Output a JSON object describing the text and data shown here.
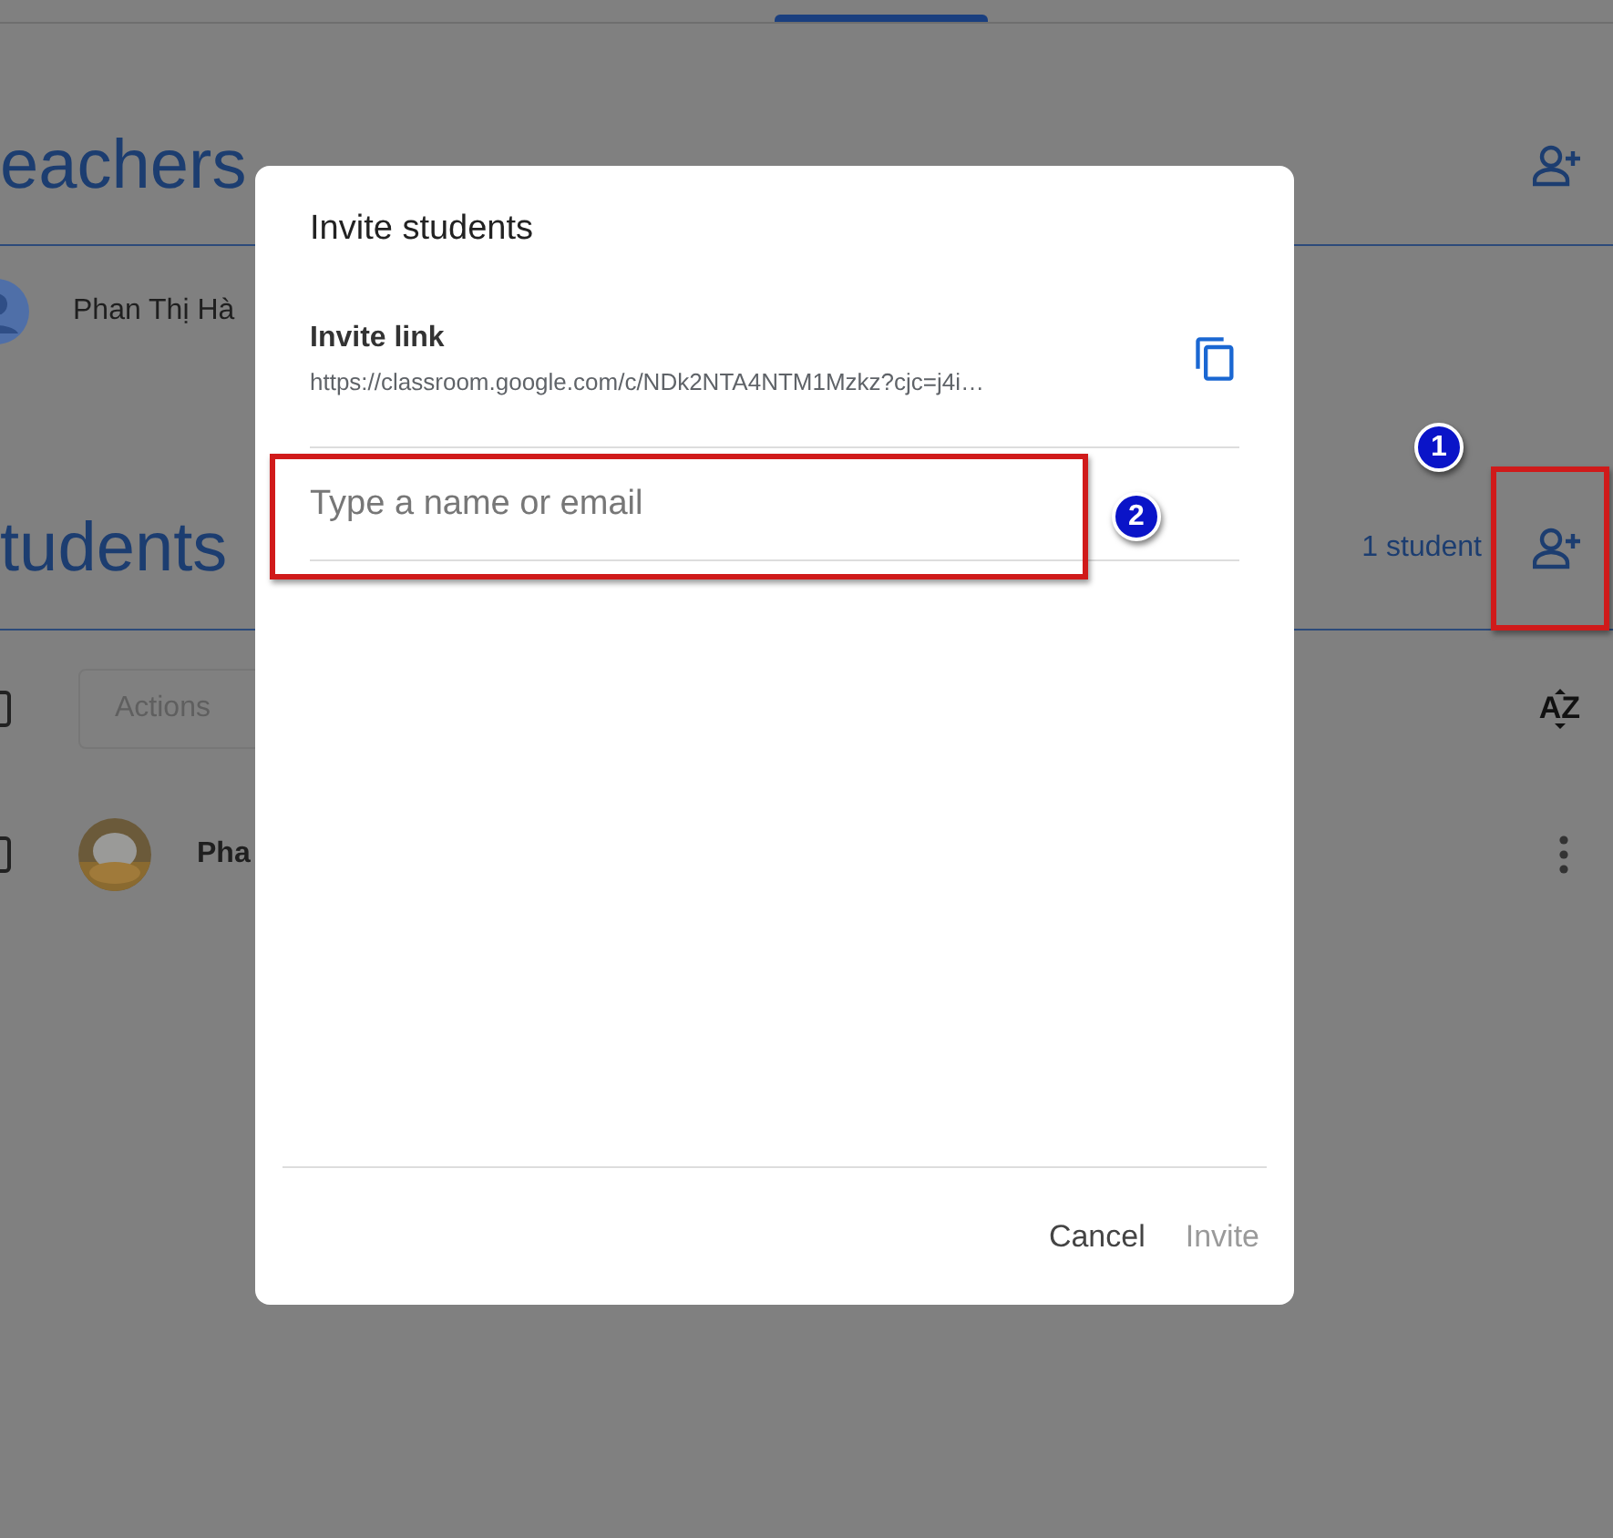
{
  "teachers": {
    "heading": "eachers",
    "members": [
      {
        "name": "Phan Thị Hà"
      }
    ]
  },
  "students": {
    "heading": "tudents",
    "count": "1 student",
    "select_all": {
      "checked": false
    },
    "actions": {
      "label": "Actions",
      "disabled": true
    },
    "sort": {
      "label": "AZ"
    },
    "members": [
      {
        "name": "Pha",
        "checked": false
      }
    ]
  },
  "dialog": {
    "title": "Invite students",
    "link_label": "Invite link",
    "link_url": "https://classroom.google.com/c/NDk2NTA4NTM1Mzkz?cjc=j4i…",
    "input": {
      "placeholder": "Type a name or email"
    },
    "buttons": [
      {
        "label": "Cancel",
        "disabled": false
      },
      {
        "label": "Invite",
        "disabled": true
      }
    ]
  },
  "annotations": [
    {
      "label": "1"
    },
    {
      "label": "2"
    }
  ]
}
